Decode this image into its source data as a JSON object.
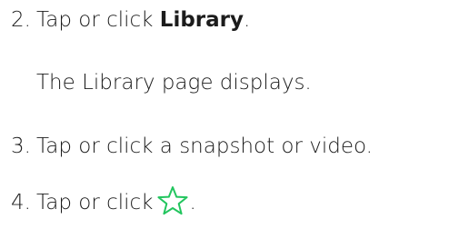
{
  "steps": [
    {
      "number": "2.",
      "text_before": "Tap or click ",
      "bold": "Library",
      "text_after": "."
    },
    {
      "note": "The Library page displays."
    },
    {
      "number": "3.",
      "text": "Tap or click a snapshot or video."
    },
    {
      "number": "4.",
      "text_before": "Tap or click",
      "icon": "star-outline-icon",
      "text_after": "."
    }
  ],
  "colors": {
    "text": "#1c1c1c",
    "icon": "#22c55e"
  }
}
